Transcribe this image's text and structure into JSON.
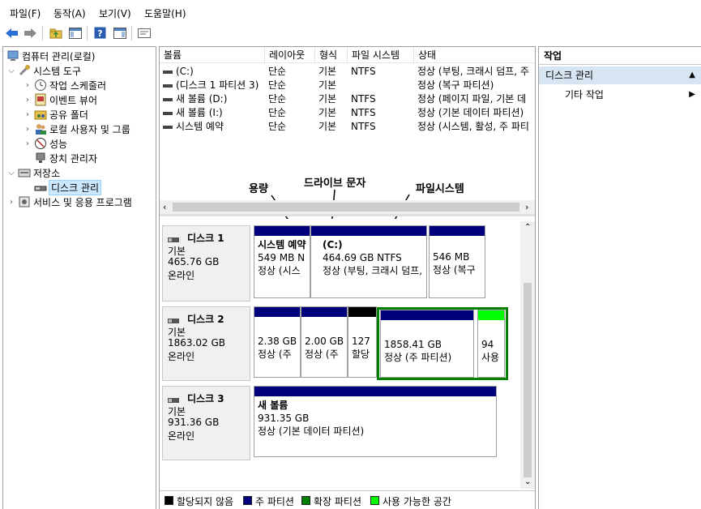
{
  "menu": [
    "파일(F)",
    "동작(A)",
    "보기(V)",
    "도움말(H)"
  ],
  "tree": {
    "root": "컴퓨터 관리(로컬)",
    "system_tools": "시스템 도구",
    "task_scheduler": "작업 스케줄러",
    "event_viewer": "이벤트 뷰어",
    "shared_folders": "공유 폴더",
    "local_users": "로컬 사용자 및 그룹",
    "performance": "성능",
    "device_manager": "장치 관리자",
    "storage": "저장소",
    "disk_management": "디스크 관리",
    "services": "서비스 및 응용 프로그램"
  },
  "volume_table": {
    "headers": [
      "볼륨",
      "레이아웃",
      "형식",
      "파일 시스템",
      "상태"
    ],
    "rows": [
      [
        "(C:)",
        "단순",
        "기본",
        "NTFS",
        "정상 (부팅, 크래시 덤프, 주"
      ],
      [
        "(디스크 1 파티션 3)",
        "단순",
        "기본",
        "",
        "정상 (복구 파티션)"
      ],
      [
        "새 볼륨 (D:)",
        "단순",
        "기본",
        "NTFS",
        "정상 (페이지 파일, 기본 데"
      ],
      [
        "새 볼륨 (I:)",
        "단순",
        "기본",
        "NTFS",
        "정상 (기본 데이터 파티션)"
      ],
      [
        "시스템 예약",
        "단순",
        "기본",
        "NTFS",
        "정상 (시스템, 활성, 주 파티"
      ]
    ]
  },
  "annotations": {
    "capacity": "용량",
    "drive_letter": "드라이브 문자",
    "filesystem": "파일시스템"
  },
  "disks": [
    {
      "name": "디스크 1",
      "type": "기본",
      "size": "465.76 GB",
      "status": "온라인",
      "partitions": [
        {
          "title": "시스템 예약",
          "size": "549 MB N",
          "state": "정상 (시스"
        },
        {
          "title": "(C:)",
          "size": "464.69 GB NTFS",
          "state": "정상 (부팅, 크래시 덤프,"
        },
        {
          "title": "",
          "size": "546 MB",
          "state": "정상 (복구"
        }
      ]
    },
    {
      "name": "디스크 2",
      "type": "기본",
      "size": "1863.02 GB",
      "status": "온라인",
      "partitions": [
        {
          "title": "",
          "size": "2.38 GB",
          "state": "정상 (주"
        },
        {
          "title": "",
          "size": "2.00 GB",
          "state": "정상 (주"
        },
        {
          "title": "",
          "size": "127",
          "state": "할당"
        },
        {
          "title": "",
          "size": "1858.41 GB",
          "state": "정상 (주 파티션)"
        },
        {
          "title": "",
          "size": "94",
          "state": "사용"
        }
      ]
    },
    {
      "name": "디스크 3",
      "type": "기본",
      "size": "931.36 GB",
      "status": "온라인",
      "partitions": [
        {
          "title": "새 볼륨",
          "size": "931.35 GB",
          "state": "정상 (기본 데이터 파티션)"
        }
      ]
    }
  ],
  "legend": [
    "할당되지 않음",
    "주 파티션",
    "확장 파티션",
    "사용 가능한 공간"
  ],
  "colors": {
    "unallocated": "#000000",
    "primary": "#00007d",
    "extended": "#008000",
    "free": "#00ff00",
    "selection": "#cce8ff",
    "actions_highlight": "#d7e4f2"
  },
  "actions": {
    "header": "작업",
    "section": "디스크 관리",
    "more": "기타 작업"
  }
}
